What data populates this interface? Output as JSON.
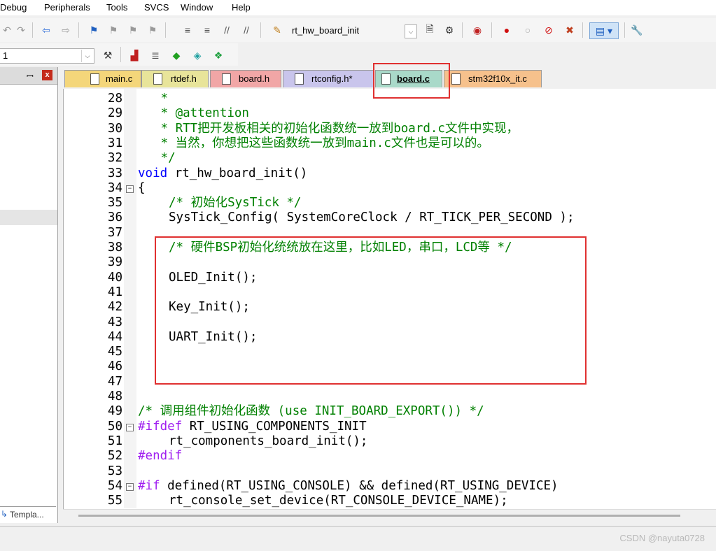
{
  "menu": {
    "items": [
      "Debug",
      "Peripherals",
      "Tools",
      "SVCS",
      "Window",
      "Help"
    ]
  },
  "toolbar": {
    "target_combo_value": "rt_hw_board_init",
    "target_select_value": "1"
  },
  "left_panel": {
    "pin": "ꟷ",
    "close": "x",
    "bottom_tab": "Templa..."
  },
  "tabs": [
    {
      "label": "main.c",
      "color": "#f4d67a"
    },
    {
      "label": "rtdef.h",
      "color": "#e8e49a"
    },
    {
      "label": "board.h",
      "color": "#f1a6a6"
    },
    {
      "label": "rtconfig.h*",
      "color": "#c9c5ec"
    },
    {
      "label": "board.c",
      "color": "#a9d9c9",
      "active": true
    },
    {
      "label": "stm32f10x_it.c",
      "color": "#f6c18c"
    }
  ],
  "code_lines": [
    {
      "n": "28",
      "text": " *"
    },
    {
      "n": "29",
      "text": " * @attention"
    },
    {
      "n": "30",
      "text": " * RTT把开发板相关的初始化函数统一放到board.c文件中实现，"
    },
    {
      "n": "31",
      "text": " * 当然，你想把这些函数统一放到main.c文件也是可以的。"
    },
    {
      "n": "32",
      "text": " */"
    },
    {
      "n": "33",
      "kw": "void",
      "text": " rt_hw_board_init()"
    },
    {
      "n": "34",
      "text": "{"
    },
    {
      "n": "35",
      "text": "/* 初始化SysTick */"
    },
    {
      "n": "36",
      "text": "SysTick_Config( SystemCoreClock / RT_TICK_PER_SECOND );"
    },
    {
      "n": "37",
      "text": ""
    },
    {
      "n": "38",
      "text": "/* 硬件BSP初始化统统放在这里，比如LED，串口，LCD等 */"
    },
    {
      "n": "39",
      "text": ""
    },
    {
      "n": "40",
      "text": "OLED_Init();"
    },
    {
      "n": "41",
      "text": ""
    },
    {
      "n": "42",
      "text": "Key_Init();"
    },
    {
      "n": "43",
      "text": ""
    },
    {
      "n": "44",
      "text": "UART_Init();"
    },
    {
      "n": "45",
      "text": ""
    },
    {
      "n": "46",
      "text": ""
    },
    {
      "n": "47",
      "text": ""
    },
    {
      "n": "48",
      "text": ""
    },
    {
      "n": "49",
      "text": "/* 调用组件初始化函数 (use INIT_BOARD_EXPORT()) */"
    },
    {
      "n": "50",
      "pp": "#ifdef",
      "text": " RT_USING_COMPONENTS_INIT"
    },
    {
      "n": "51",
      "text": "rt_components_board_init();"
    },
    {
      "n": "52",
      "pp": "#endif",
      "text": ""
    },
    {
      "n": "53",
      "text": ""
    },
    {
      "n": "54",
      "pp": "#if",
      "text": " defined(RT_USING_CONSOLE) && defined(RT_USING_DEVICE)"
    },
    {
      "n": "55",
      "text": "rt_console_set_device(RT_CONSOLE_DEVICE_NAME);"
    }
  ],
  "watermark": "CSDN @nayuta0728",
  "colors": {
    "comment": "#008000",
    "keyword": "#0000ff",
    "preprocessor": "#a020f0",
    "highlight_box": "#e03030"
  }
}
